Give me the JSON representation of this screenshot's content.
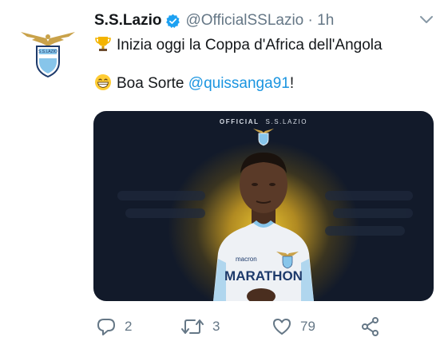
{
  "tweet": {
    "author_name": "S.S.Lazio",
    "handle": "@OfficialSSLazio",
    "separator": "·",
    "time": "1h",
    "line1_text": "Inizia oggi la Coppa d'Africa dell'Angola",
    "line2_prefix": "Boa Sorte ",
    "mention": "@quissanga91",
    "line2_suffix": "!"
  },
  "media": {
    "overlay_official": "OFFICIAL",
    "overlay_club": "S.S.LAZIO",
    "shirt_sponsor": "MARATHON",
    "kit_brand": "macron"
  },
  "actions": {
    "replies": "2",
    "retweets": "3",
    "likes": "79"
  },
  "colors": {
    "link": "#1b95e0",
    "secondary_text": "#657786",
    "verified": "#1da1f2",
    "lazio_sky_blue": "#87c5ea"
  },
  "icons": [
    "lazio-crest-icon",
    "verified-badge-icon",
    "caret-down-icon",
    "trophy-icon",
    "grin-face-icon",
    "reply-icon",
    "retweet-icon",
    "like-icon",
    "share-icon"
  ]
}
